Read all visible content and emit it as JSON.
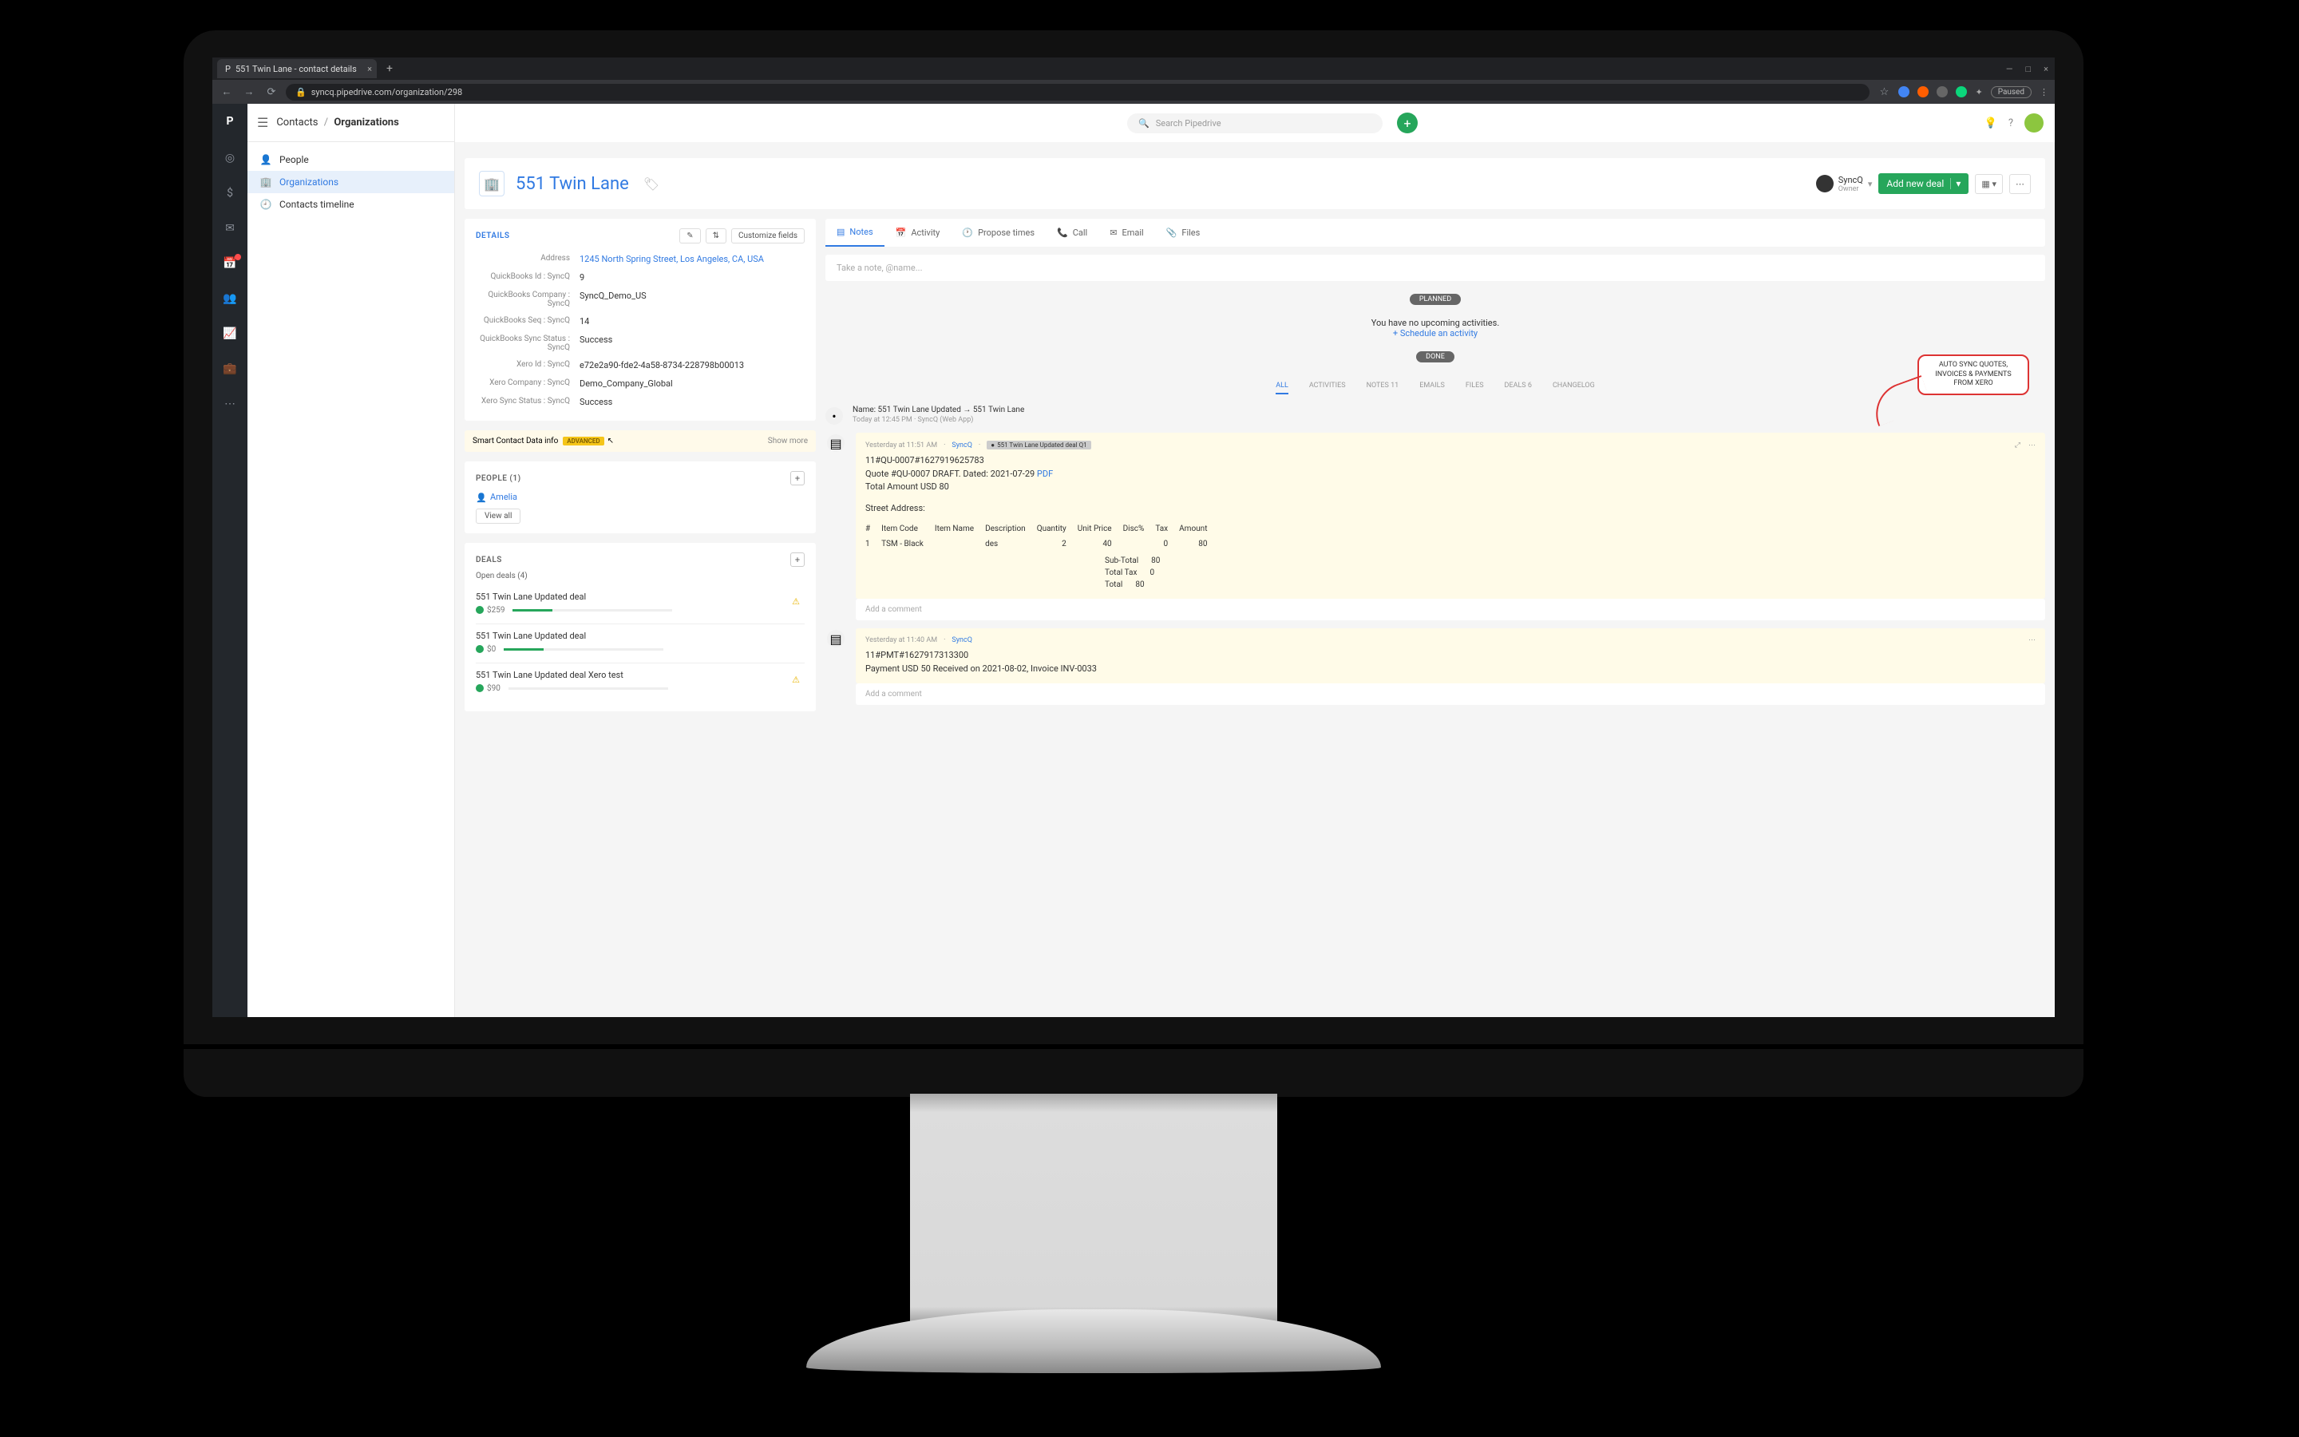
{
  "browser": {
    "tab_title": "551 Twin Lane - contact details",
    "url": "syncq.pipedrive.com/organization/298",
    "paused": "Paused"
  },
  "breadcrumb": {
    "lvl1": "Contacts",
    "lvl2": "Organizations"
  },
  "search": {
    "placeholder": "Search Pipedrive"
  },
  "subnav": {
    "people": "People",
    "organizations": "Organizations",
    "timeline": "Contacts timeline"
  },
  "header": {
    "title": "551 Twin Lane",
    "owner_name": "SyncQ",
    "owner_sub": "Owner",
    "new_deal": "Add new deal"
  },
  "details": {
    "heading": "DETAILS",
    "customize": "Customize fields",
    "fields": [
      {
        "label": "Address",
        "value": "1245 North Spring Street, Los Angeles, CA, USA",
        "link": true
      },
      {
        "label": "QuickBooks Id : SyncQ",
        "value": "9"
      },
      {
        "label": "QuickBooks Company : SyncQ",
        "value": "SyncQ_Demo_US"
      },
      {
        "label": "QuickBooks Seq : SyncQ",
        "value": "14"
      },
      {
        "label": "QuickBooks Sync Status : SyncQ",
        "value": "Success"
      },
      {
        "label": "Xero Id : SyncQ",
        "value": "e72e2a90-fde2-4a58-8734-228798b00013"
      },
      {
        "label": "Xero Company : SyncQ",
        "value": "Demo_Company_Global"
      },
      {
        "label": "Xero Sync Status : SyncQ",
        "value": "Success"
      }
    ],
    "smart": "Smart Contact Data info",
    "advanced": "ADVANCED",
    "show_more": "Show more"
  },
  "people": {
    "heading": "PEOPLE (1)",
    "name": "Amelia",
    "view_all": "View all"
  },
  "deals": {
    "heading": "DEALS",
    "open": "Open deals (4)",
    "items": [
      {
        "title": "551 Twin Lane Updated deal",
        "amount": "$259",
        "warn": true
      },
      {
        "title": "551 Twin Lane Updated deal",
        "amount": "$0",
        "warn": false
      },
      {
        "title": "551 Twin Lane Updated deal Xero test",
        "amount": "$90",
        "warn": true
      }
    ]
  },
  "tabs": {
    "notes": "Notes",
    "activity": "Activity",
    "propose": "Propose times",
    "call": "Call",
    "email": "Email",
    "files": "Files"
  },
  "compose": {
    "placeholder": "Take a note, @name..."
  },
  "planned": {
    "chip": "PLANNED",
    "text": "You have no upcoming activities.",
    "link": "+ Schedule an activity"
  },
  "done_chip": "DONE",
  "filters": {
    "all": "ALL",
    "activities": "ACTIVITIES",
    "notes": "NOTES",
    "notes_n": "11",
    "emails": "EMAILS",
    "files": "FILES",
    "deals": "DEALS",
    "deals_n": "6",
    "changelog": "CHANGELOG"
  },
  "callout": "AUTO SYNC QUOTES, INVOICES & PAYMENTS FROM XERO",
  "timeline": {
    "name_change": {
      "title": "Name: 551 Twin Lane Updated → 551 Twin Lane",
      "meta": "Today at 12:45 PM  ·  SyncQ (Web App)"
    },
    "note1": {
      "time": "Yesterday at 11:51 AM",
      "user": "SyncQ",
      "deal": "551 Twin Lane Updated deal Q1",
      "l1": "11#QU-0007#1627919625783",
      "l2a": "Quote #QU-0007 DRAFT. Dated: 2021-07-29 ",
      "l2b": "PDF",
      "l3": "Total Amount USD 80",
      "addr": "Street Address:",
      "th": [
        "#",
        "Item Code",
        "Item Name",
        "Description",
        "Quantity",
        "Unit Price",
        "Disc%",
        "Tax",
        "Amount"
      ],
      "row": [
        "1",
        "TSM - Black",
        "",
        "des",
        "2",
        "40",
        "",
        "0",
        "80"
      ],
      "totals": [
        [
          "Sub-Total",
          "80"
        ],
        [
          "Total Tax",
          "0"
        ],
        [
          "Total",
          "80"
        ]
      ]
    },
    "note2": {
      "time": "Yesterday at 11:40 AM",
      "user": "SyncQ",
      "l1": "11#PMT#1627917313300",
      "l2": "Payment USD 50 Received on 2021-08-02, Invoice INV-0033"
    },
    "add_comment": "Add a comment"
  }
}
